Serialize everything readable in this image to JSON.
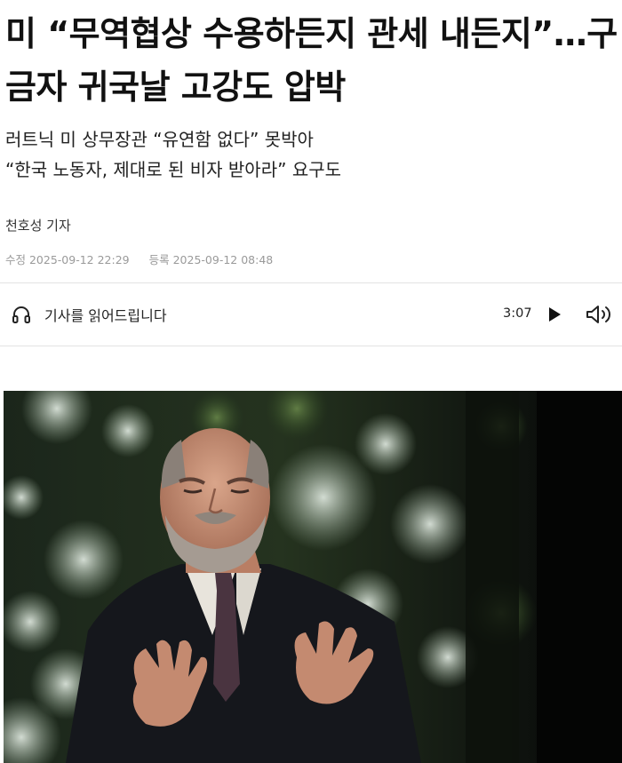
{
  "article": {
    "headline": "미 “무역협상 수용하든지 관세 내든지”…구금자 귀국날 고강도 압박",
    "subtitle": [
      "러트닉 미 상무장관 “유연함 없다” 못박아",
      "“한국 노동자, 제대로 된 비자 받아라” 요구도"
    ],
    "reporter": "천호성 기자",
    "modified": "수정 2025-09-12 22:29",
    "registered": "등록 2025-09-12 08:48"
  },
  "audio_player": {
    "listen_label": "기사를 읽어드립니다",
    "duration": "3:07",
    "icons": {
      "headphones": "headphones-icon",
      "play": "play-icon",
      "volume": "volume-icon"
    }
  },
  "photo": {
    "description_icon": "news-photo"
  },
  "colors": {
    "text": "#111111",
    "meta_gray": "#9a9a9a",
    "divider": "#e3e3e3"
  }
}
